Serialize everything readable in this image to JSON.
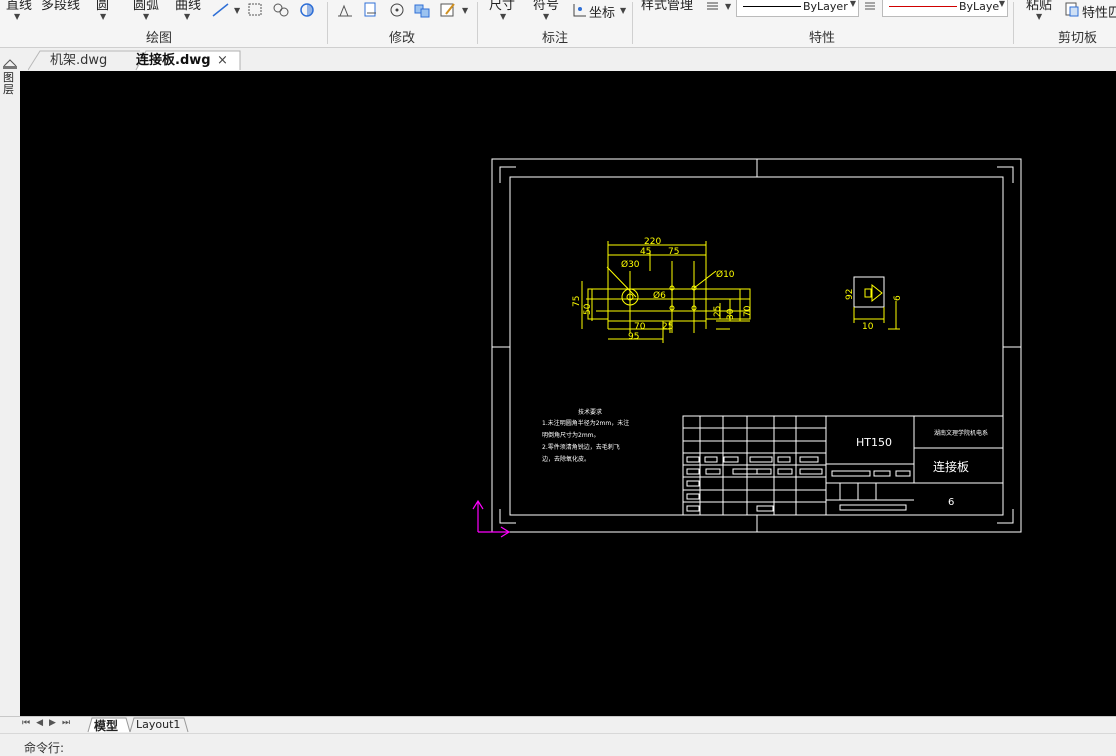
{
  "ribbon": {
    "draw_tools": [
      "直线",
      "多段线",
      "圆",
      "圆弧",
      "曲线"
    ],
    "annotate_tools": [
      "尺寸",
      "符号"
    ],
    "coord_label": "坐标",
    "style_manager_label": "样式管理",
    "paste_label": "粘贴",
    "properties_match_label": "特性匹",
    "linetype_combo": "ByLayer",
    "color_combo": "ByLaye",
    "groups": [
      "绘图",
      "修改",
      "标注",
      "特性",
      "剪切板"
    ]
  },
  "tabs": [
    {
      "label": "机架.dwg",
      "active": false
    },
    {
      "label": "连接板.dwg",
      "active": true
    }
  ],
  "tab_close_glyph": "×",
  "left_rail_label": "图层",
  "drawing": {
    "dims": {
      "d220": "220",
      "d45": "45",
      "d75_top": "75",
      "phi30": "Ø30",
      "phi10": "Ø10",
      "phi6": "Ø6",
      "d75_left": "75",
      "d50": "50",
      "d70_bottom": "70",
      "d95": "95",
      "d25_bottom": "25",
      "d25_right": "25",
      "d30": "30",
      "d70_right": "70",
      "side_92": "92",
      "side_6": "6",
      "side_10": "10"
    },
    "notes_title": "技术要求",
    "notes_lines": [
      "1.未注明圆角半径为2mm，未注",
      "明倒角尺寸为2mm。",
      "2.零件须清角锐边，去毛刺飞",
      "边，去除氧化皮。"
    ],
    "material": "HT150",
    "school": "湖南文理学院机电系",
    "part_name": "连接板",
    "sheet_no": "6"
  },
  "layout_tabs": [
    "模型",
    "Layout1"
  ],
  "command_prompt": "命令行:",
  "colors": {
    "canvas": "#000000",
    "frame": "#ffffff",
    "geometry": "#ffff00",
    "ucs": "#ff00ff"
  }
}
